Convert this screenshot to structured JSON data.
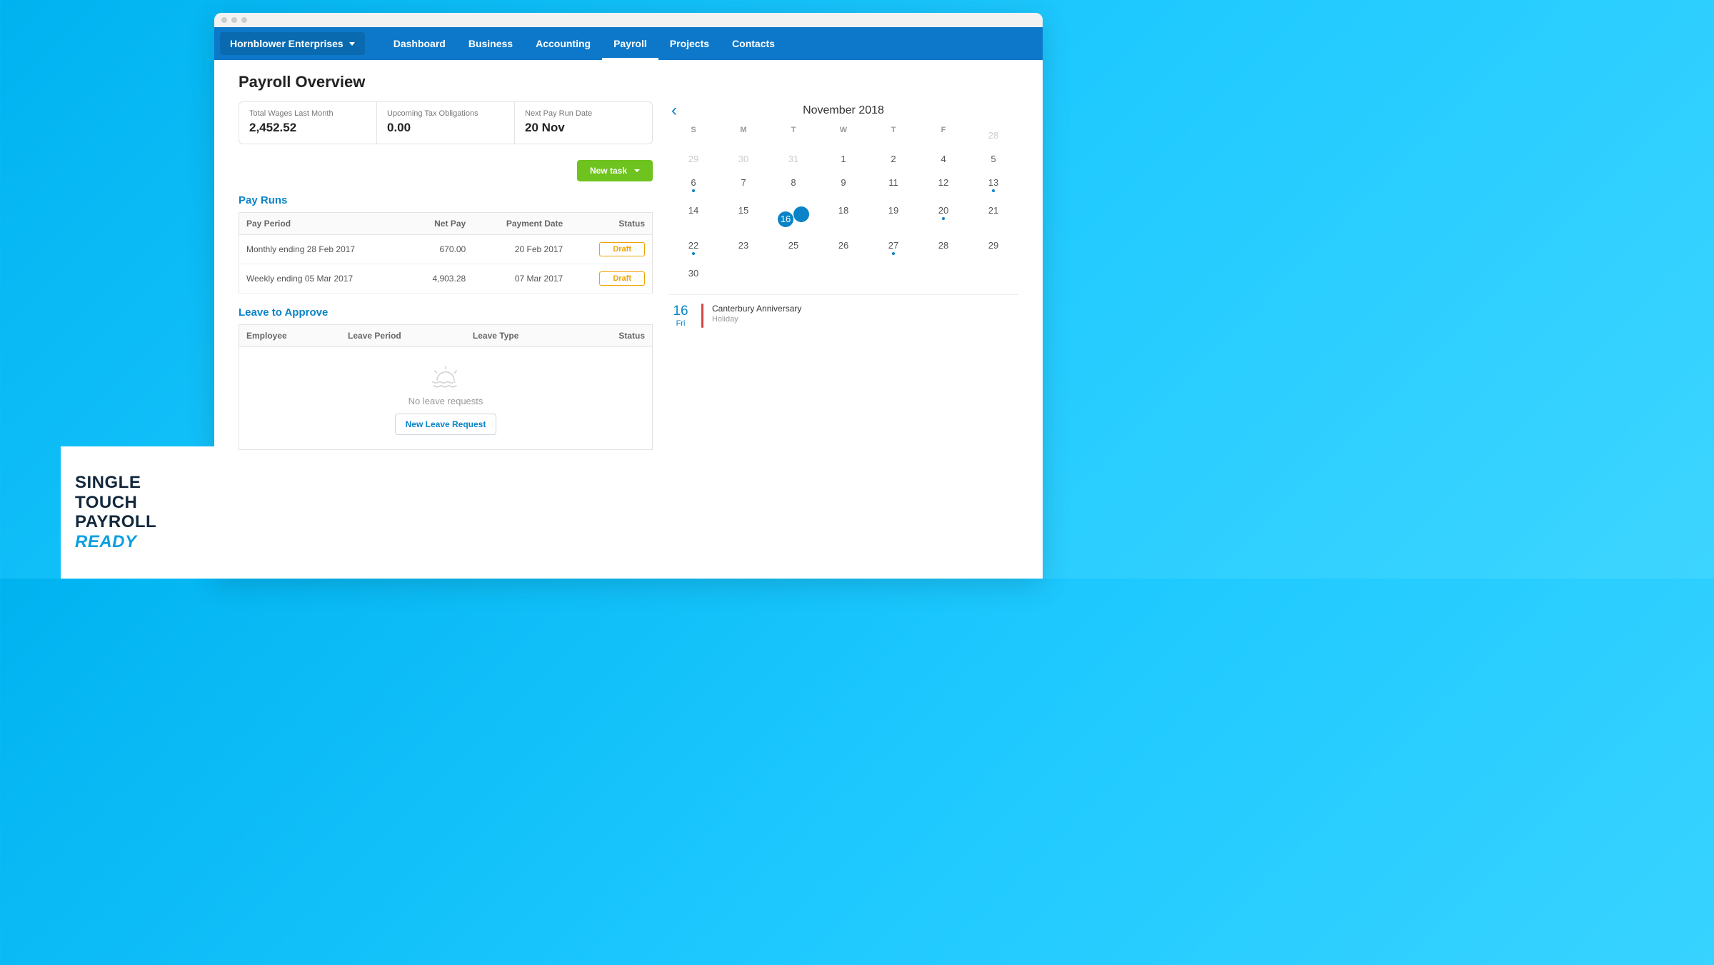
{
  "org_name": "Hornblower Enterprises",
  "nav": {
    "items": [
      "Dashboard",
      "Business",
      "Accounting",
      "Payroll",
      "Projects",
      "Contacts"
    ],
    "active_index": 3
  },
  "page_title": "Payroll Overview",
  "metrics": [
    {
      "label": "Total Wages Last Month",
      "value": "2,452.52"
    },
    {
      "label": "Upcoming Tax Obligations",
      "value": "0.00"
    },
    {
      "label": "Next Pay Run Date",
      "value": "20 Nov"
    }
  ],
  "new_task_label": "New task",
  "sections": {
    "payruns_title": "Pay Runs",
    "leave_title": "Leave to Approve"
  },
  "payruns": {
    "headers": [
      "Pay Period",
      "Net Pay",
      "Payment Date",
      "Status"
    ],
    "rows": [
      {
        "period": "Monthly ending 28 Feb 2017",
        "net": "670.00",
        "date": "20 Feb 2017",
        "status": "Draft"
      },
      {
        "period": "Weekly ending 05 Mar 2017",
        "net": "4,903.28",
        "date": "07 Mar 2017",
        "status": "Draft"
      }
    ]
  },
  "leave": {
    "headers": [
      "Employee",
      "Leave Period",
      "Leave Type",
      "Status"
    ],
    "empty_text": "No leave requests",
    "new_label": "New Leave Request"
  },
  "calendar": {
    "title": "November 2018",
    "weekdays": [
      "S",
      "M",
      "T",
      "W",
      "T",
      "F"
    ],
    "cells": [
      {
        "d": "28",
        "muted": true
      },
      {
        "d": "29",
        "muted": true
      },
      {
        "d": "30",
        "muted": true
      },
      {
        "d": "31",
        "muted": true
      },
      {
        "d": "1"
      },
      {
        "d": "2"
      },
      {
        "d": "4"
      },
      {
        "d": "5"
      },
      {
        "d": "6",
        "dot": "blue"
      },
      {
        "d": "7"
      },
      {
        "d": "8"
      },
      {
        "d": "9"
      },
      {
        "d": "11"
      },
      {
        "d": "12"
      },
      {
        "d": "13",
        "dot": "blue"
      },
      {
        "d": "14"
      },
      {
        "d": "15"
      },
      {
        "d": "16",
        "today": true,
        "dot": "red"
      },
      {
        "d": "18"
      },
      {
        "d": "19"
      },
      {
        "d": "20",
        "dot": "blue"
      },
      {
        "d": "21"
      },
      {
        "d": "22",
        "dot": "blue"
      },
      {
        "d": "23"
      },
      {
        "d": "25"
      },
      {
        "d": "26"
      },
      {
        "d": "27",
        "dot": "blue"
      },
      {
        "d": "28"
      },
      {
        "d": "29"
      },
      {
        "d": "30"
      }
    ],
    "event": {
      "day": "16",
      "dow": "Fri",
      "title": "Canterbury Anniversary",
      "sub": "Holiday"
    }
  },
  "badge": {
    "l1": "SINGLE",
    "l2": "TOUCH",
    "l3": "PAYROLL",
    "l4": "READY"
  }
}
